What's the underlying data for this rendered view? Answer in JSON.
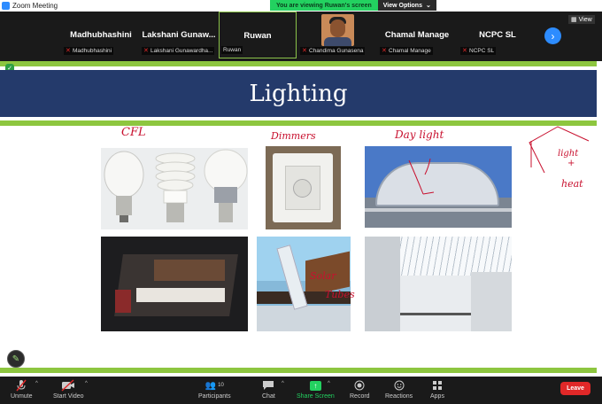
{
  "window": {
    "title": "Zoom Meeting"
  },
  "share_banner": {
    "message": "You are viewing Ruwan's screen",
    "view_options": "View Options"
  },
  "gallery": {
    "view_label": "View",
    "participants": [
      {
        "big_name": "Madhubhashini",
        "label": "Madhubhashini"
      },
      {
        "big_name": "Lakshani  Gunaw...",
        "label": "Lakshani Gunawardha..."
      },
      {
        "big_name": "Ruwan",
        "label": "Ruwan",
        "active": true
      },
      {
        "big_name": "",
        "label": "Chandima Gunasena",
        "video": true
      },
      {
        "big_name": "Chamal Manage",
        "label": "Chamal Manage"
      },
      {
        "big_name": "NCPC SL",
        "label": "NCPC SL"
      }
    ]
  },
  "slide": {
    "title": "Lighting",
    "annotations": {
      "cfl": "CFL",
      "dimmers": "Dimmers",
      "day_light": "Day light",
      "light": "light",
      "plus": "+",
      "heat": "heat",
      "solar": "Solar",
      "tubes": "Tubes"
    },
    "images": [
      "light-bulbs",
      "dimmer-switch",
      "skylight-dome",
      "interior-room",
      "solar-tube",
      "glass-roof-atrium"
    ]
  },
  "toolbar": {
    "unmute": "Unmute",
    "start_video": "Start Video",
    "participants": "Participants",
    "participants_count": "10",
    "chat": "Chat",
    "share_screen": "Share Screen",
    "record": "Record",
    "reactions": "Reactions",
    "apps": "Apps",
    "leave": "Leave"
  },
  "colors": {
    "slide_title_bg": "#243a6b",
    "accent_green": "#8dc63f",
    "share_green": "#23d160",
    "annotation_red": "#c8102e",
    "leave_red": "#e02828",
    "zoom_blue": "#2d8cff"
  }
}
